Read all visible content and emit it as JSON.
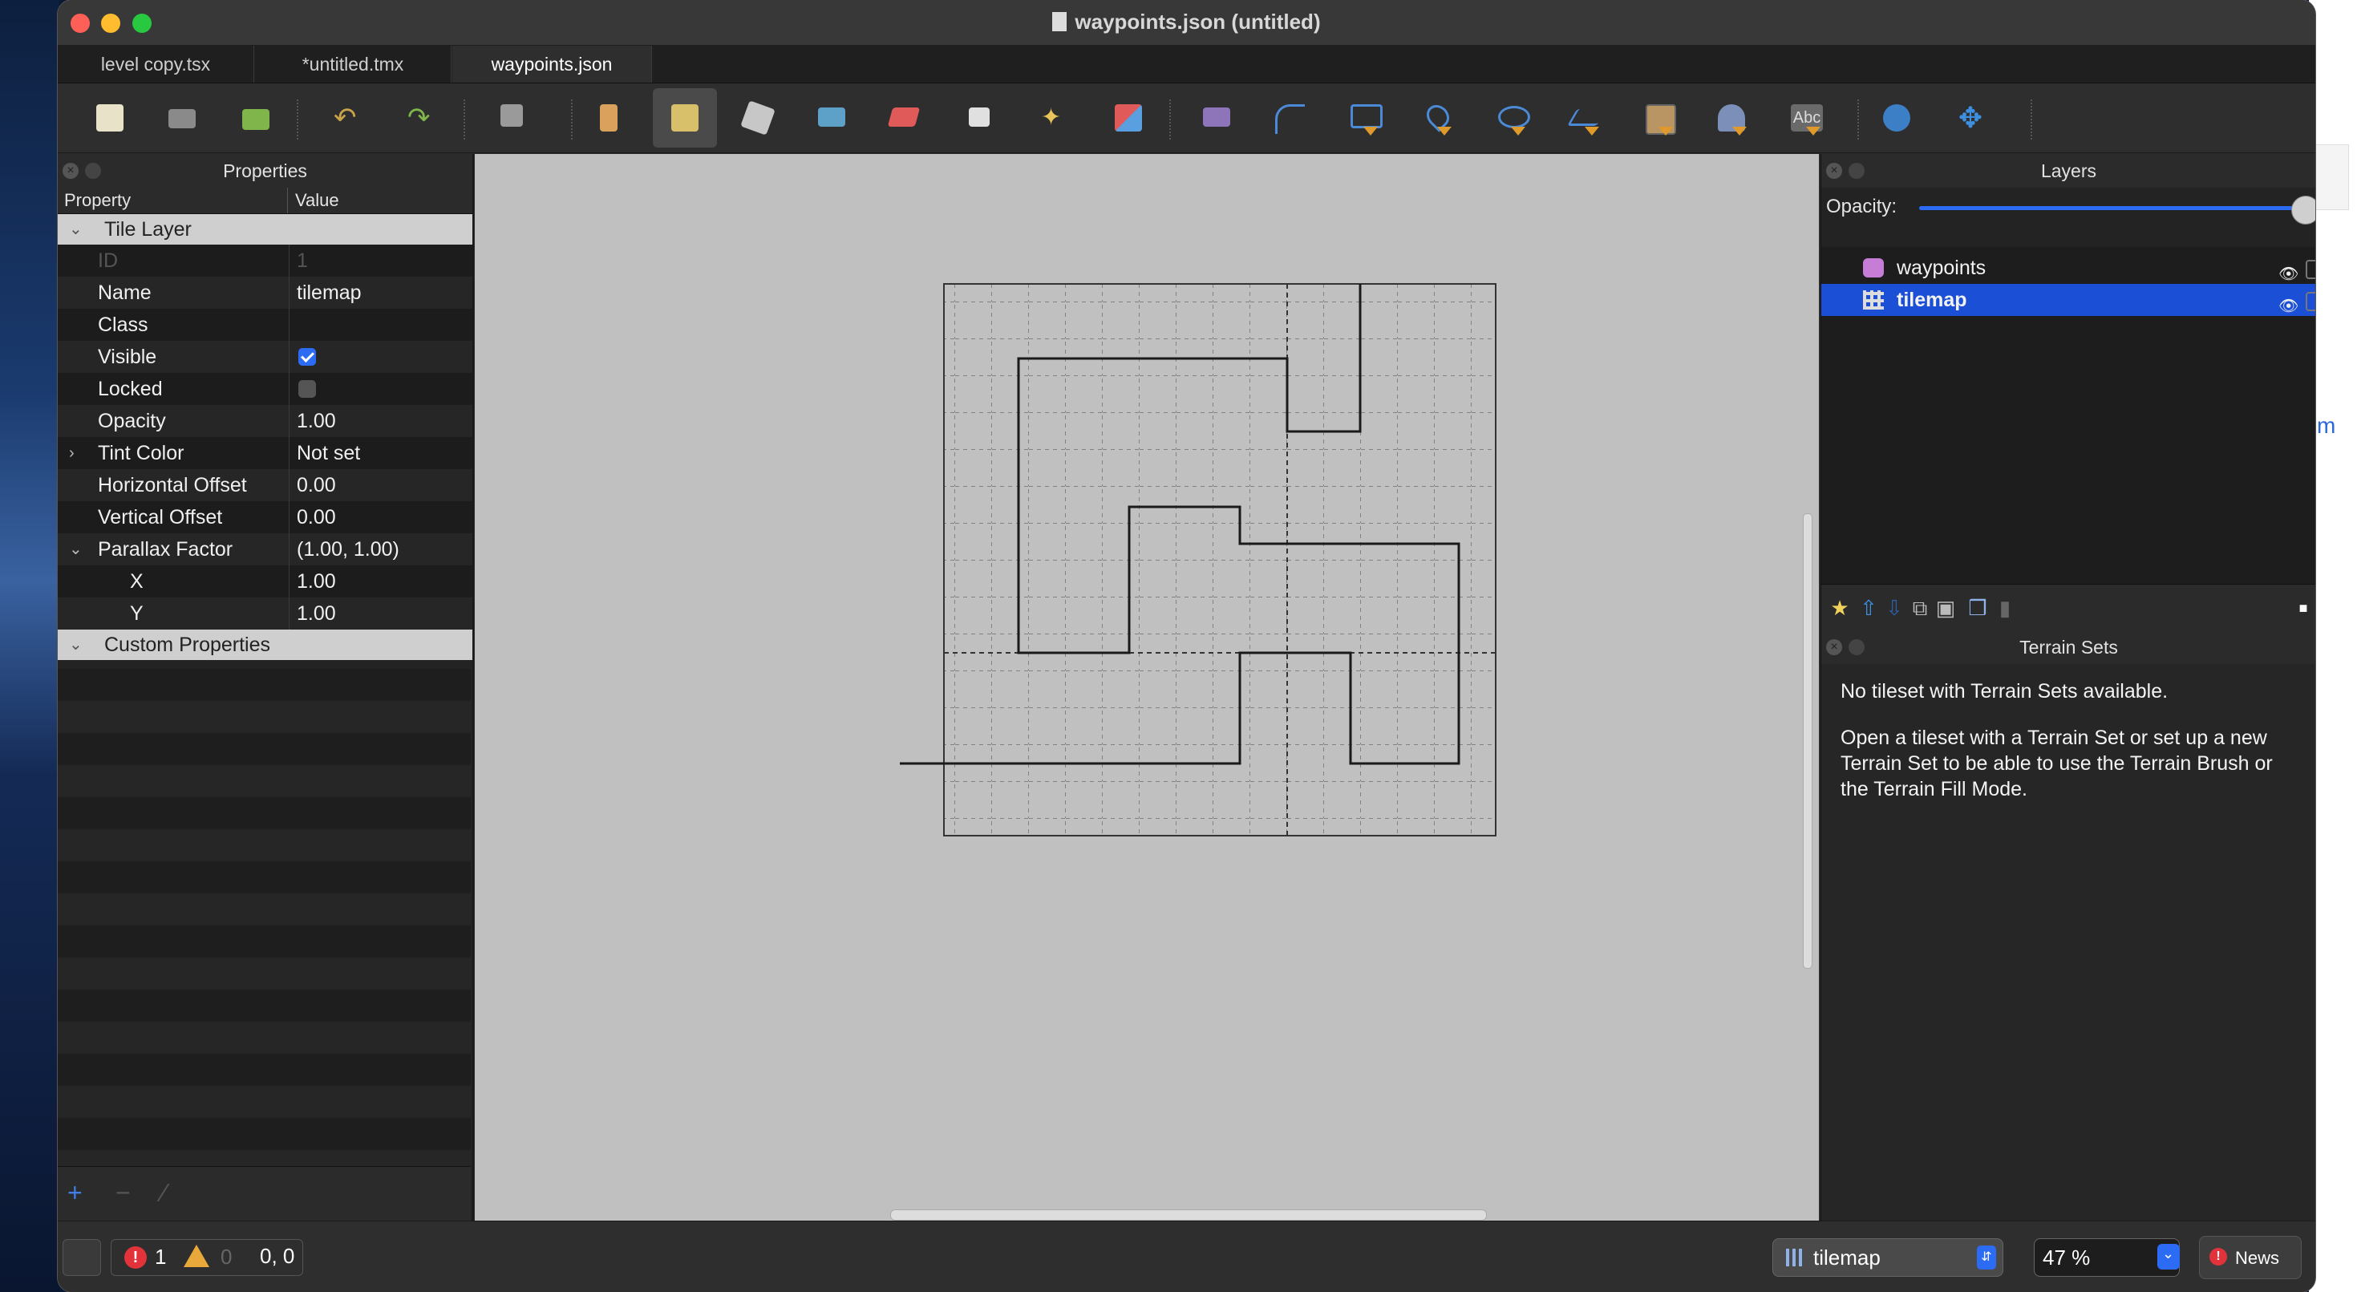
{
  "window": {
    "title": "waypoints.json (untitled)"
  },
  "tabs": [
    {
      "label": "level copy.tsx"
    },
    {
      "label": "*untitled.tmx"
    },
    {
      "label": "waypoints.json",
      "active": true
    }
  ],
  "toolbar": {
    "tools": [
      "new-map-icon",
      "open-icon",
      "save-icon",
      "undo-icon",
      "redo-icon",
      "random-mode-icon",
      "stamp-brush-icon",
      "terrain-brush-icon",
      "bucket-fill-icon",
      "shape-fill-icon",
      "eraser-icon",
      "rectangle-select-icon",
      "magic-wand-icon",
      "select-same-tile-icon",
      "select-objects-icon",
      "edit-polygons-icon",
      "insert-rectangle-icon",
      "insert-point-icon",
      "insert-ellipse-icon",
      "insert-polygon-icon",
      "insert-tile-icon",
      "insert-template-icon",
      "insert-text-icon",
      "world-tool-icon",
      "move-icon"
    ]
  },
  "properties": {
    "panel_title": "Properties",
    "col_property": "Property",
    "col_value": "Value",
    "group_tile_layer": "Tile Layer",
    "rows": [
      {
        "key": "ID",
        "value": "1"
      },
      {
        "key": "Name",
        "value": "tilemap"
      },
      {
        "key": "Class",
        "value": ""
      },
      {
        "key": "Visible",
        "value": true
      },
      {
        "key": "Locked",
        "value": false
      },
      {
        "key": "Opacity",
        "value": "1.00"
      },
      {
        "key": "Tint Color",
        "value": "Not set"
      },
      {
        "key": "Horizontal Offset",
        "value": "0.00"
      },
      {
        "key": "Vertical Offset",
        "value": "0.00"
      },
      {
        "key": "Parallax Factor",
        "value": "(1.00, 1.00)"
      },
      {
        "key": "X",
        "value": "1.00"
      },
      {
        "key": "Y",
        "value": "1.00"
      }
    ],
    "group_custom": "Custom Properties"
  },
  "layers": {
    "panel_title": "Layers",
    "opacity_label": "Opacity:",
    "opacity_value": 1.0,
    "items": [
      {
        "name": "waypoints",
        "type": "object-layer"
      },
      {
        "name": "tilemap",
        "type": "tile-layer",
        "selected": true
      }
    ]
  },
  "terrain": {
    "panel_title": "Terrain Sets",
    "message1": "No tileset with Terrain Sets available.",
    "message2": "Open a tileset with a Terrain Set or set up a new Terrain Set to be able to use the Terrain Brush or the Terrain Fill Mode."
  },
  "status": {
    "errors": "1",
    "warnings": "0",
    "cursor": "0, 0",
    "current_layer": "tilemap",
    "zoom": "47 %",
    "news": "News"
  },
  "colors": {
    "accent": "#2c6cf5",
    "selection": "#1b4fd6",
    "error": "#e2333b",
    "warning": "#e9a93a"
  }
}
